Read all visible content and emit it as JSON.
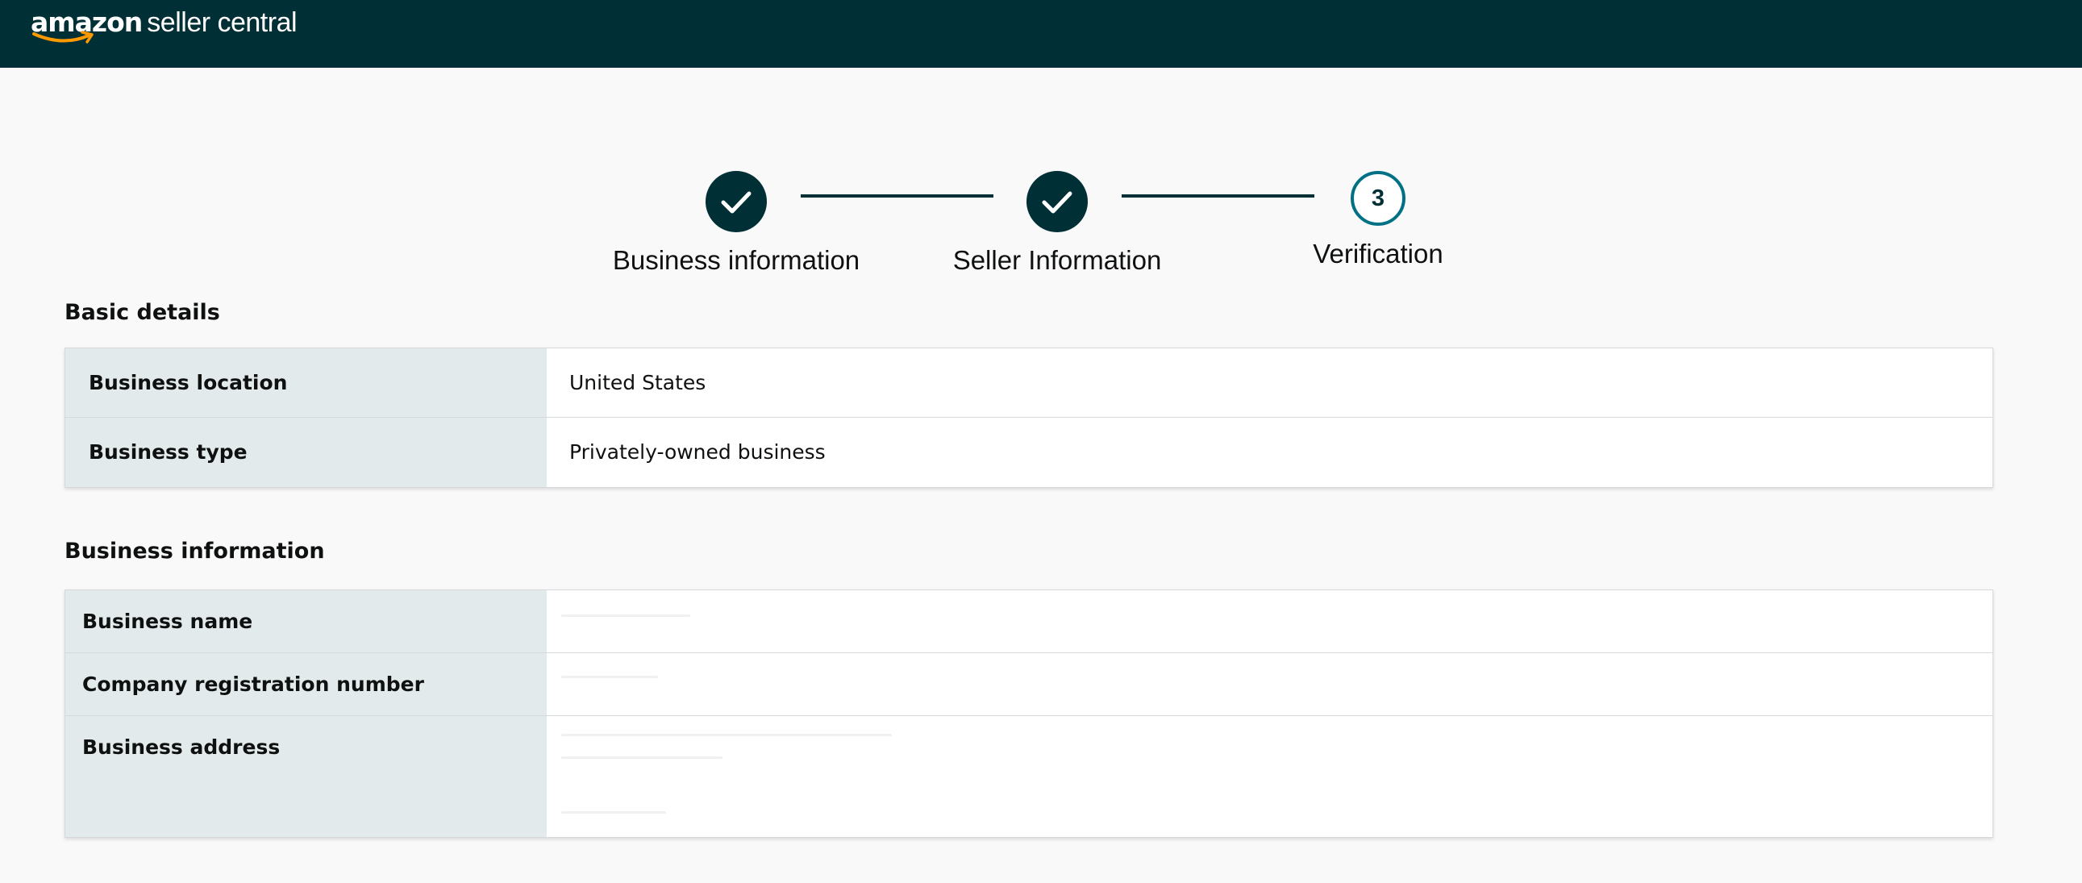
{
  "header": {
    "logo_brand": "amazon",
    "logo_product": "seller central",
    "background": "#002f36"
  },
  "stepper": {
    "steps": [
      {
        "label": "Business information",
        "state": "complete",
        "icon": "checkmark-icon"
      },
      {
        "label": "Seller Information",
        "state": "complete",
        "icon": "checkmark-icon"
      },
      {
        "label": "Verification",
        "state": "current",
        "number": "3"
      }
    ],
    "complete_color": "#002f36",
    "current_color": "#007185"
  },
  "basic_details": {
    "title": "Basic details",
    "rows": [
      {
        "label": "Business location",
        "value": "United States"
      },
      {
        "label": "Business type",
        "value": "Privately-owned business"
      }
    ]
  },
  "business_information": {
    "title": "Business information",
    "rows": [
      {
        "label": "Business name",
        "value": ""
      },
      {
        "label": "Company registration number",
        "value": ""
      },
      {
        "label": "Business address",
        "value": ""
      }
    ]
  }
}
